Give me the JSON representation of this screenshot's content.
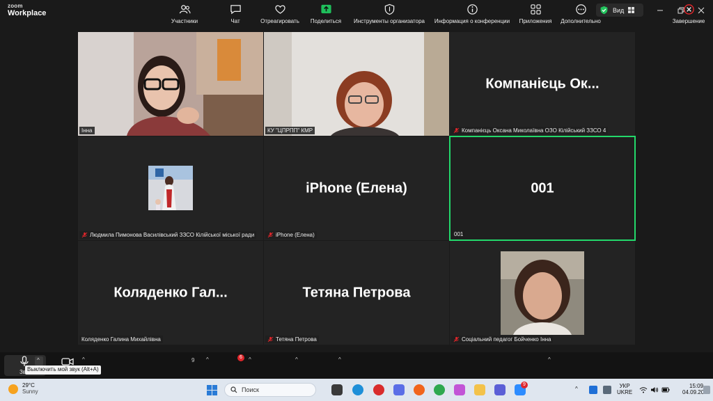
{
  "app": {
    "logo_top": "zoom",
    "logo_bottom": "Workplace",
    "view_label": "Вид"
  },
  "tiles": [
    {
      "tag": "Інна",
      "big_name": "",
      "muted": false,
      "active": false
    },
    {
      "tag": "КУ \"ЦПРПП\" КМР",
      "big_name": "",
      "muted": false,
      "active": false
    },
    {
      "tag": "Компанієць Оксана Миколаївна ОЗО Кілійський ЗЗСО 4",
      "big_name": "Компанієць Ок...",
      "muted": true,
      "active": false
    },
    {
      "tag": "Людмила Пимонова Василівський ЗЗСО Кілійської міської ради",
      "big_name": "",
      "muted": true,
      "active": false
    },
    {
      "tag": "iPhone (Елена)",
      "big_name": "iPhone (Елена)",
      "muted": true,
      "active": false
    },
    {
      "tag": "001",
      "big_name": "001",
      "muted": false,
      "active": true
    },
    {
      "tag": "Коляденко Галина Михайлівна",
      "big_name": "Коляденко  Гал...",
      "muted": false,
      "active": false
    },
    {
      "tag": "Тетяна Петрова",
      "big_name": "Тетяна Петрова",
      "muted": true,
      "active": false
    },
    {
      "tag": "Соціальний педагог Бойченко Інна",
      "big_name": "",
      "muted": true,
      "active": false
    }
  ],
  "toolbar": {
    "mic_label": "Зв",
    "mute_tooltip": "Выключить мой звук (Alt+A)",
    "participants_label": "Участники",
    "participants_count": "9",
    "chat_label": "Чат",
    "chat_badge": "6",
    "react_label": "Отреагировать",
    "share_label": "Поделиться",
    "host_tools_label": "Инструменты организатора",
    "meeting_info_label": "Информация о конференции",
    "apps_label": "Приложения",
    "more_label": "Дополнительно",
    "end_label": "Завершение"
  },
  "taskbar": {
    "temperature": "29°C",
    "condition": "Sunny",
    "search_placeholder": "Поиск",
    "lang_top": "УКР",
    "lang_bottom": "UKRE",
    "time": "15:09",
    "date": "04.09.2025",
    "zoom_badge": "9"
  },
  "colors": {
    "active_border": "#23d96b",
    "muted_red": "#e0262b",
    "share_green": "#1fbf5b"
  }
}
